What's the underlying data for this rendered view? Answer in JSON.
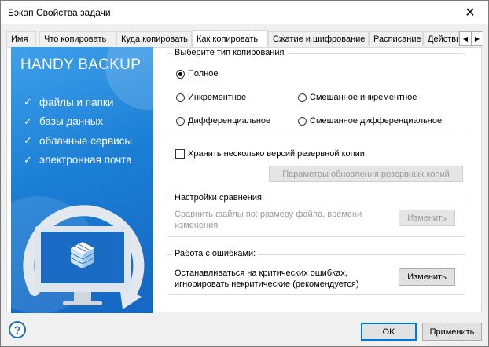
{
  "window": {
    "title": "Бэкап Свойства задачи"
  },
  "tabs": [
    {
      "label": "Имя"
    },
    {
      "label": "Что копировать"
    },
    {
      "label": "Куда копировать"
    },
    {
      "label": "Как копировать"
    },
    {
      "label": "Сжатие и шифрование"
    },
    {
      "label": "Расписание"
    },
    {
      "label": "Действи"
    }
  ],
  "banner": {
    "brand": "HANDY BACKUP",
    "features": [
      "файлы и папки",
      "базы данных",
      "облачные сервисы",
      "электронная почта"
    ],
    "colors": {
      "top": "#3fa0ea",
      "bottom": "#1466c2"
    }
  },
  "copy_type": {
    "legend": "Выберите тип копирования",
    "options": [
      {
        "label": "Полное",
        "selected": true
      },
      {
        "label": "Инкрементное",
        "selected": false
      },
      {
        "label": "Смешанное инкрементное",
        "selected": false
      },
      {
        "label": "Дифференциальное",
        "selected": false
      },
      {
        "label": "Смешанное дифференциальное",
        "selected": false
      }
    ]
  },
  "versions": {
    "checkbox_label": "Хранить несколько версий резервной копии",
    "checked": false,
    "params_button": "Параметры обновления резервных копий"
  },
  "compare": {
    "legend": "Настройки сравнения:",
    "text": "Сравнить файлы по: размеру файла, времени изменения",
    "button": "Изменить"
  },
  "errors": {
    "legend": "Работа с ошибками:",
    "text": "Останавливаться на критических ошибках, игнорировать некритические (рекомендуется)",
    "button": "Изменить"
  },
  "footer": {
    "help": "?",
    "ok": "OK",
    "apply": "Применить"
  }
}
